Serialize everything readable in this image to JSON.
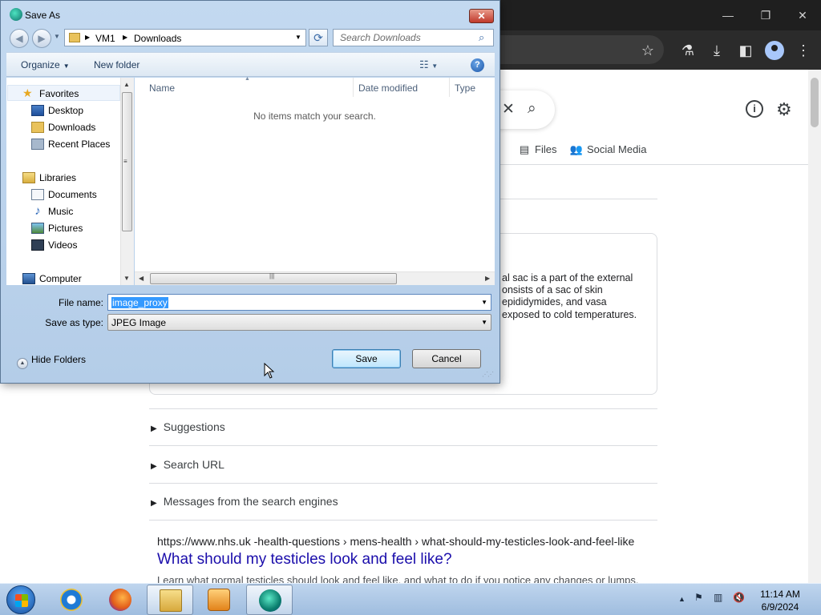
{
  "browser": {
    "toolbar_icons": [
      "star-icon",
      "flask-icon",
      "download-icon",
      "sidebar-icon",
      "profile-icon",
      "kebab-menu-icon"
    ],
    "filters": [
      {
        "icon": "files-icon",
        "label": "Files"
      },
      {
        "icon": "social-media-icon",
        "label": "Social Media"
      }
    ],
    "card_text": [
      "al sac is a part of the external",
      "onsists of a sac of skin",
      "epididymides, and vasa",
      "exposed to cold temperatures."
    ],
    "sections": [
      "Suggestions",
      "Search URL",
      "Messages from the search engines"
    ],
    "result": {
      "url": "https://www.nhs.uk  -health-questions › mens-health › what-should-my-testicles-look-and-feel-like",
      "title": "What should my testicles look and feel like?",
      "snippet": "Learn what normal testicles should look and feel like, and what to do if you notice any changes or lumps."
    }
  },
  "dialog": {
    "title": "Save As",
    "close_label": "✕",
    "address": {
      "crumbs": [
        "VM1",
        "Downloads"
      ]
    },
    "search_placeholder": "Search Downloads",
    "organize_label": "Organize",
    "new_folder_label": "New folder",
    "nav": {
      "favorites": "Favorites",
      "favorites_items": [
        "Desktop",
        "Downloads",
        "Recent Places"
      ],
      "libraries": "Libraries",
      "libraries_items": [
        "Documents",
        "Music",
        "Pictures",
        "Videos"
      ],
      "computer": "Computer"
    },
    "columns": [
      "Name",
      "Date modified",
      "Type"
    ],
    "empty_message": "No items match your search.",
    "file_name_label": "File name:",
    "file_name_value": "image_proxy",
    "save_as_type_label": "Save as type:",
    "save_as_type_value": "JPEG Image",
    "hide_folders_label": "Hide Folders",
    "save_label": "Save",
    "cancel_label": "Cancel"
  },
  "taskbar": {
    "apps": [
      "internet-explorer",
      "firefox",
      "windows-explorer",
      "media-player",
      "edge-browser"
    ],
    "time": "11:14 AM",
    "date": "6/9/2024"
  }
}
